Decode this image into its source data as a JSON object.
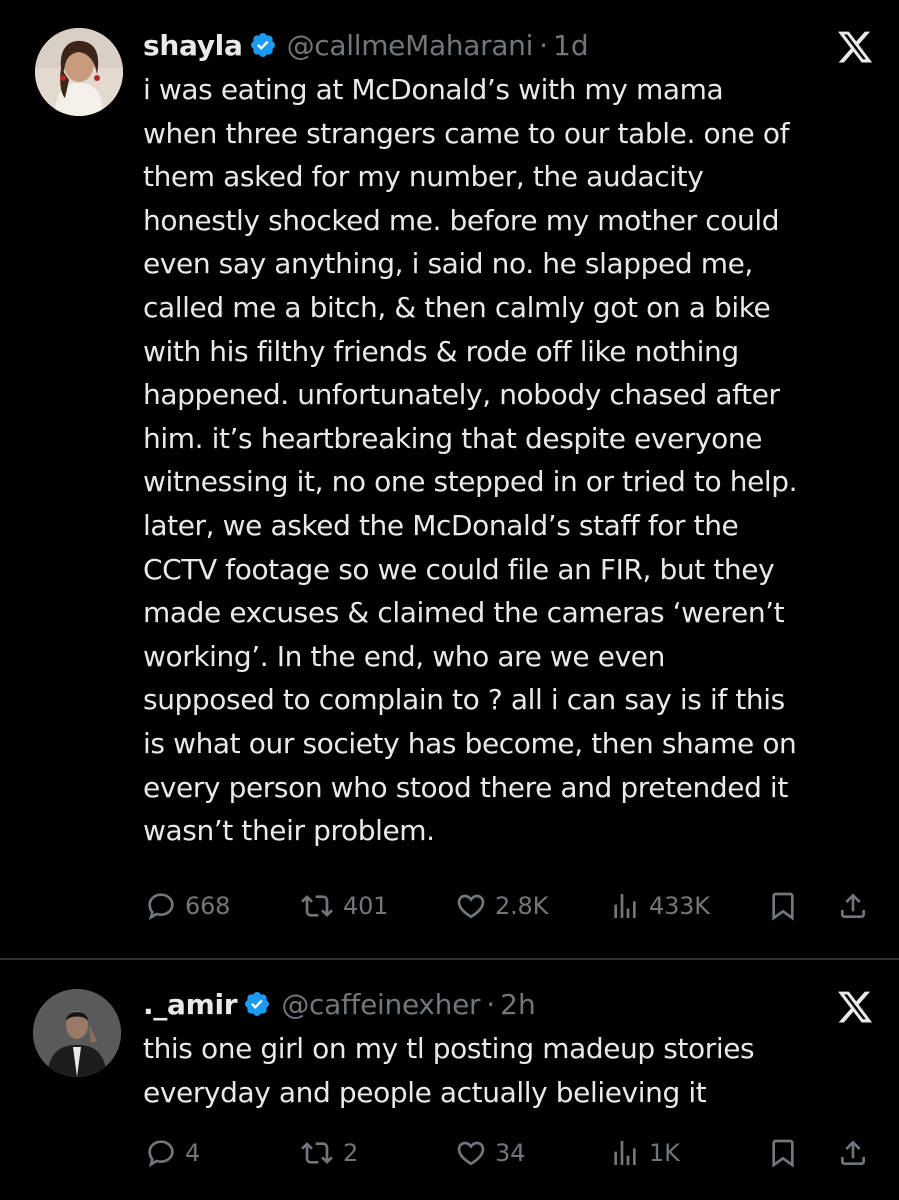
{
  "tweets": [
    {
      "display_name": "shayla",
      "handle": "@callmeMaharani",
      "separator": "·",
      "time": "1d",
      "text": "i was eating at McDonald’s with my mama\nwhen three strangers came to our table. one of\nthem asked for my number, the audacity\nhonestly shocked me. before my mother could\neven say anything, i said no. he slapped me,\ncalled me a bitch, & then calmly got on a bike\nwith his filthy friends & rode off like nothing\nhappened. unfortunately, nobody chased after\nhim. it’s heartbreaking that despite everyone\nwitnessing it, no one stepped in or tried to help.\nlater, we asked the McDonald’s staff for the\nCCTV footage so we could file an FIR, but they\nmade excuses & claimed the cameras ‘weren’t\nworking’. In the end, who are we even\nsupposed to complain to ? all i can say is if this\nis what our society has become, then shame on\nevery person who stood there and pretended it\nwasn’t their problem.",
      "replies": "668",
      "reposts": "401",
      "likes": "2.8K",
      "views": "433K"
    },
    {
      "display_name": "._amir",
      "handle": "@caffeinexher",
      "separator": "·",
      "time": "2h",
      "text": "this one girl on my tl posting madeup stories\neveryday and people actually believing it",
      "replies": "4",
      "reposts": "2",
      "likes": "34",
      "views": "1K"
    }
  ],
  "icons": {
    "verified": "verified-badge-icon",
    "logo": "x-logo-icon",
    "reply": "reply-icon",
    "repost": "repost-icon",
    "like": "heart-icon",
    "views": "views-icon",
    "bookmark": "bookmark-icon",
    "share": "share-icon"
  },
  "colors": {
    "background": "#000000",
    "text": "#e7e9ea",
    "muted": "#71767b",
    "verified": "#1d9bf0",
    "divider": "#2f3336"
  }
}
